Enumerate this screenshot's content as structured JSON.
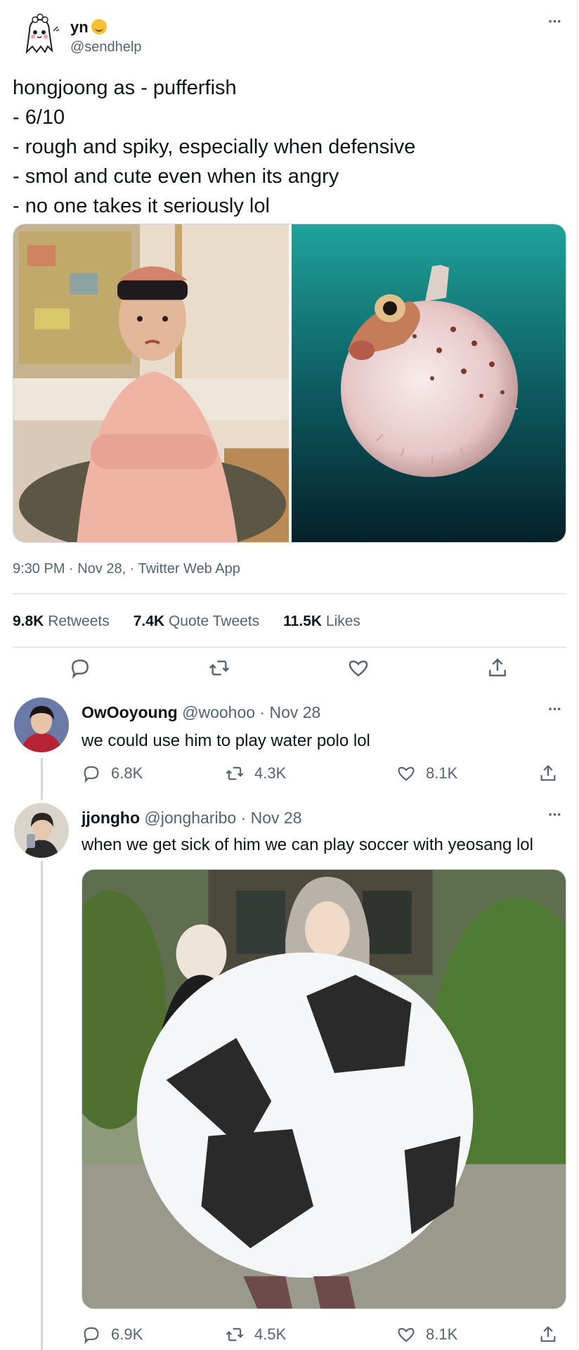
{
  "main_tweet": {
    "display_name": "yn",
    "emoji_icon": "upside-down-face-emoji",
    "handle": "@sendhelp",
    "text_lines": [
      "hongjoong as - pufferfish",
      "- 6/10",
      "- rough and spiky, especially when defensive",
      "- smol and cute even when its angry",
      "- no one takes it seriously lol"
    ],
    "timestamp": "9:30 PM · Nov 28, · Twitter Web App",
    "stats": {
      "retweets_count": "9.8K",
      "retweets_label": "Retweets",
      "quote_count": "7.4K",
      "quote_label": "Quote Tweets",
      "likes_count": "11.5K",
      "likes_label": "Likes"
    },
    "actions": [
      "reply-icon",
      "retweet-icon",
      "like-icon",
      "share-icon"
    ]
  },
  "replies": [
    {
      "display_name": "OwOoyoung",
      "handle": "@woohoo",
      "date": "· Nov 28",
      "text": "we could use him to play water polo lol",
      "reply_count": "6.8K",
      "retweet_count": "4.3K",
      "like_count": "8.1K"
    },
    {
      "display_name": "jjongho",
      "handle": "@jongharibo",
      "date": "· Nov 28",
      "text": "when we get sick of him we can play soccer with yeosang lol",
      "reply_count": "6.9K",
      "retweet_count": "4.5K",
      "like_count": "8.1K"
    }
  ],
  "colors": {
    "text_primary": "#0f1419",
    "text_secondary": "#536471",
    "border": "#cfd9de"
  }
}
